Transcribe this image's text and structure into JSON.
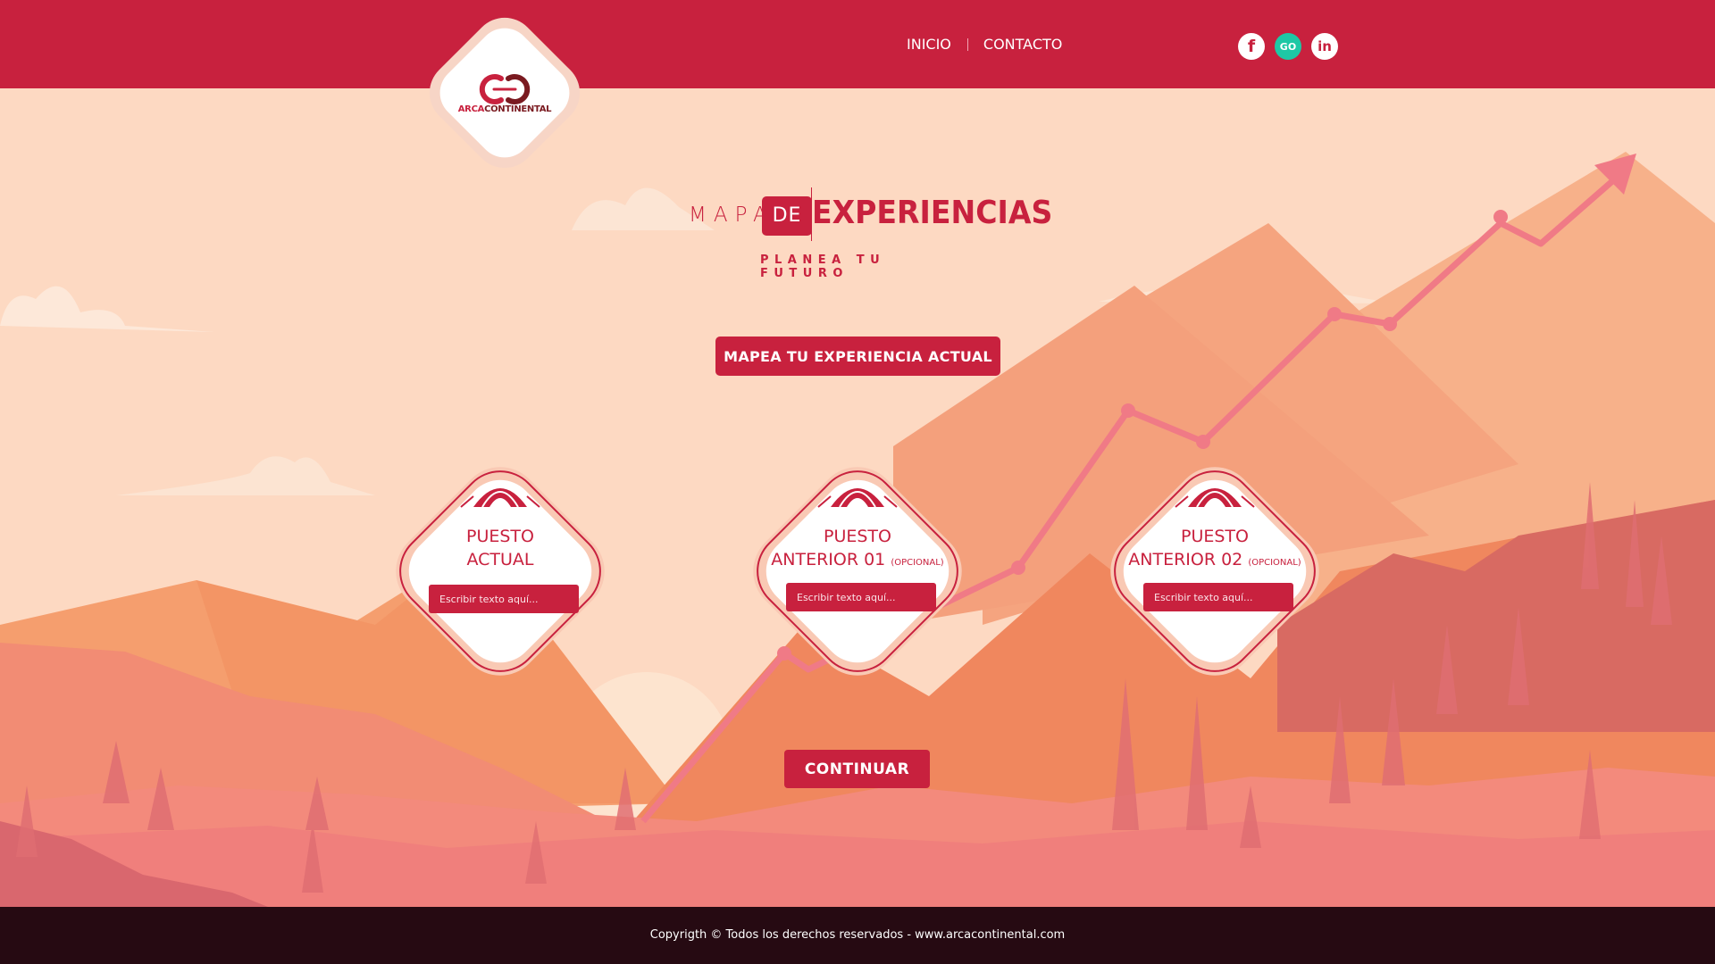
{
  "brand": {
    "logo_part1": "ARCA",
    "logo_part2": "CONTINENTAL"
  },
  "nav": {
    "inicio": "INICIO",
    "contacto": "CONTACTO"
  },
  "social": {
    "facebook": "f",
    "go": "GO",
    "linkedin": "in"
  },
  "hero": {
    "mapa": "MAPA",
    "de": "DE",
    "experiencias": "EXPERIENCIAS",
    "subtitle": "PLANEA TU FUTURO"
  },
  "cta": {
    "map_button": "MAPEA TU EXPERIENCIA ACTUAL",
    "continue_button": "CONTINUAR"
  },
  "cards": [
    {
      "line1": "PUESTO",
      "line2": "ACTUAL",
      "optional": "",
      "placeholder": "Escribir texto aquí..."
    },
    {
      "line1": "PUESTO",
      "line2": "ANTERIOR 01",
      "optional": "(OPCIONAL)",
      "placeholder": "Escribir texto aquí..."
    },
    {
      "line1": "PUESTO",
      "line2": "ANTERIOR 02",
      "optional": "(OPCIONAL)",
      "placeholder": "Escribir texto aquí..."
    }
  ],
  "footer": {
    "text": "Copyrigth © Todos los derechos reservados - www.arcacontinental.com"
  },
  "colors": {
    "primary": "#c8213e",
    "footer": "#260a12",
    "sky": "#fdd9c2",
    "go_icon": "#1ec8a5"
  },
  "icons": [
    "facebook-icon",
    "go-icon",
    "linkedin-icon",
    "tent-icon",
    "logo-icon"
  ]
}
